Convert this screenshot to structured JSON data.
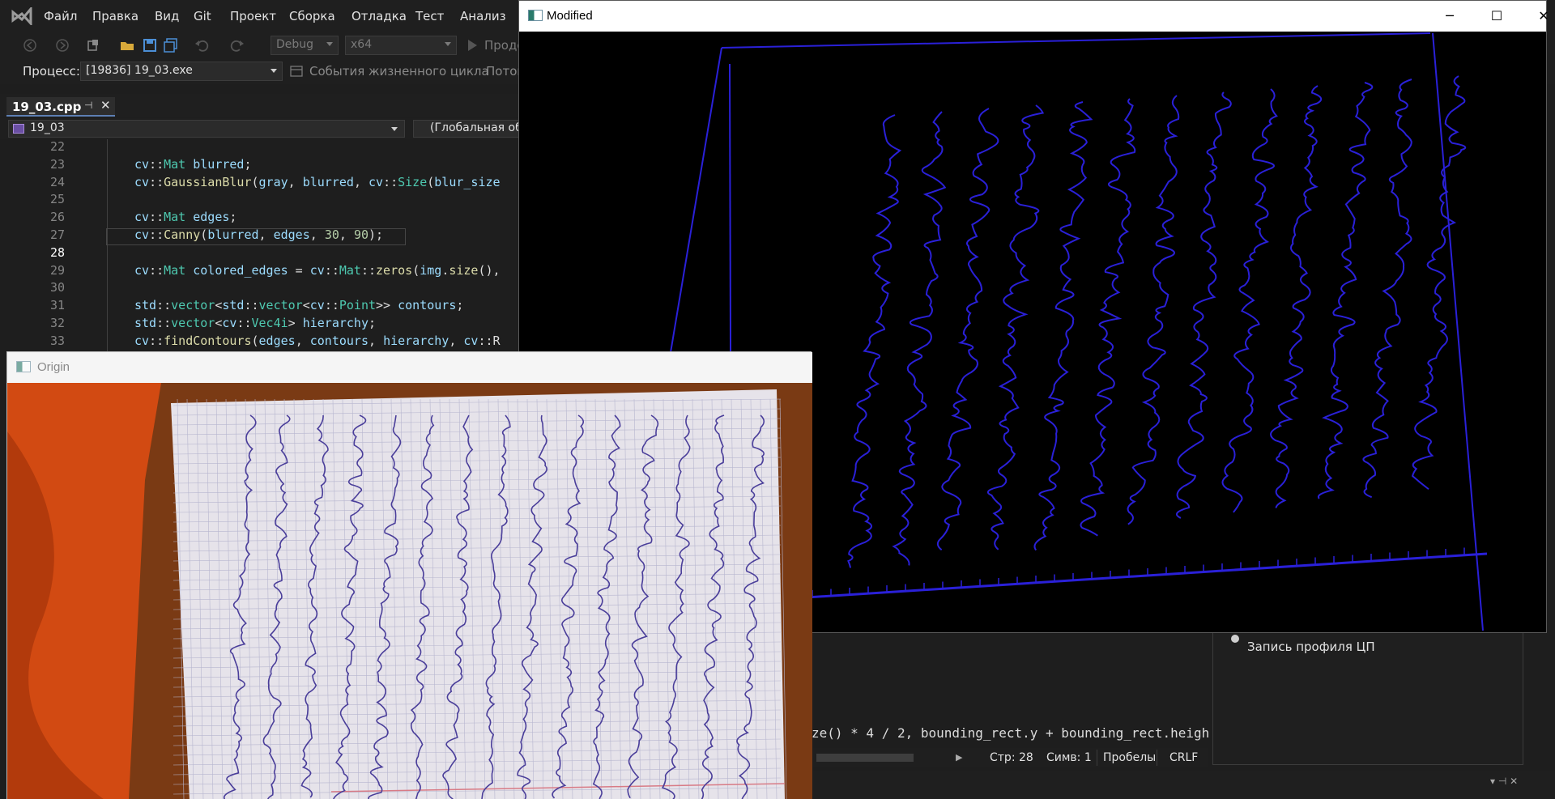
{
  "ide": {
    "menu": [
      "Файл",
      "Правка",
      "Вид",
      "Git",
      "Проект",
      "Сборка",
      "Отладка",
      "Тест",
      "Анализ"
    ],
    "toolbar": {
      "config": "Debug",
      "platform": "x64",
      "run_label": "Продо"
    },
    "process": {
      "label": "Процесс:",
      "value": "[19836] 19_03.exe",
      "lifecycle": "События жизненного цикла",
      "thread": "Поток"
    },
    "tab": {
      "title": "19_03.cpp"
    },
    "nav": {
      "project": "19_03",
      "scope": "(Глобальная обл"
    },
    "code": [
      {
        "num": "22",
        "text": ""
      },
      {
        "num": "23",
        "text": "cv::Mat blurred;"
      },
      {
        "num": "24",
        "text": "cv::GaussianBlur(gray, blurred, cv::Size(blur_size"
      },
      {
        "num": "25",
        "text": ""
      },
      {
        "num": "26",
        "text": "cv::Mat edges;"
      },
      {
        "num": "27",
        "text": "cv::Canny(blurred, edges, 30, 90);"
      },
      {
        "num": "28",
        "text": ""
      },
      {
        "num": "29",
        "text": "cv::Mat colored_edges = cv::Mat::zeros(img.size(),"
      },
      {
        "num": "30",
        "text": ""
      },
      {
        "num": "31",
        "text": "std::vector<std::vector<cv::Point>> contours;"
      },
      {
        "num": "32",
        "text": "std::vector<cv::Vec4i> hierarchy;"
      },
      {
        "num": "33",
        "text": "cv::findContours(edges, contours, hierarchy, cv::R"
      }
    ],
    "current_line": "28",
    "diagnostics": {
      "cpu_profile": "Запись профиля ЦП"
    },
    "bottom_code": "ze() * 4 / 2, bounding_rect.y + bounding_rect.heigh",
    "status": {
      "line": "Стр: 28",
      "col": "Симв: 1",
      "whitespace": "Пробелы",
      "eol": "CRLF"
    }
  },
  "windows": {
    "modified": {
      "title": "Modified",
      "edge_color": "#2a20d8"
    },
    "origin": {
      "title": "Origin"
    }
  }
}
